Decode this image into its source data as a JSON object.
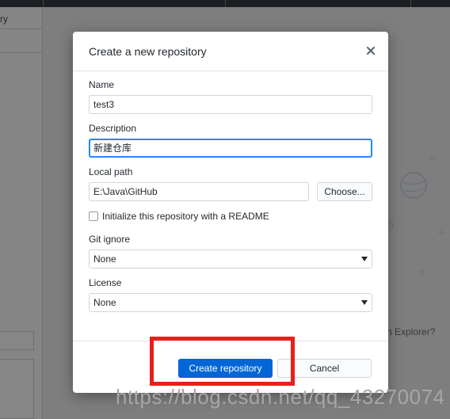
{
  "background": {
    "left_crumb": "ry",
    "hint_text": "n Explorer?"
  },
  "dialog": {
    "title": "Create a new repository",
    "close_icon": "close-icon",
    "name": {
      "label": "Name",
      "value": "test3"
    },
    "description": {
      "label": "Description",
      "value": "新建仓库"
    },
    "local_path": {
      "label": "Local path",
      "value": "E:\\Java\\GitHub",
      "choose_label": "Choose..."
    },
    "readme": {
      "label": "Initialize this repository with a README",
      "checked": false
    },
    "git_ignore": {
      "label": "Git ignore",
      "value": "None"
    },
    "license": {
      "label": "License",
      "value": "None"
    },
    "create_label": "Create repository",
    "cancel_label": "Cancel"
  },
  "overlay": {
    "watermark": "https://blog.csdn.net/qq_43270074",
    "highlight_color": "#e8201c"
  },
  "colors": {
    "accent": "#0366d6",
    "focus": "#2188ff"
  }
}
